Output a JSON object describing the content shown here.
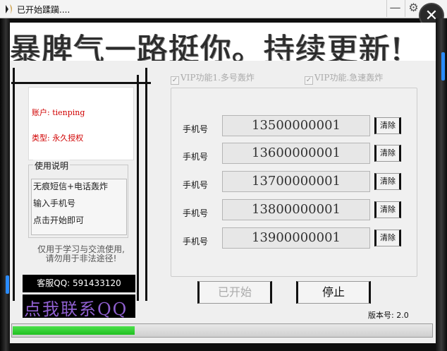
{
  "window": {
    "title": "已开始蹂躏...."
  },
  "titlebar": {
    "minimize_glyph": "—",
    "gear_glyph": "⚙",
    "close_glyph": "✕"
  },
  "banner": {
    "text": "暴脾气一路挺你。持续更新!"
  },
  "account": {
    "user_line": "账户: tienping",
    "type_line": "类型: 永久授权"
  },
  "instructions": {
    "title": "使用说明",
    "items": [
      "无痕短信+电话轰炸",
      "输入手机号",
      "点击开始即可"
    ]
  },
  "notice": {
    "line1": "仅用于学习与交流使用,",
    "line2": "请勿用于非法途径!"
  },
  "support": {
    "qq": "客服QQ: 591433120",
    "link": "点我联系QQ"
  },
  "vip": {
    "option1": "VIP功能1.多号轰炸",
    "option2": "VIP功能.急速轰炸",
    "check_glyph": "✓"
  },
  "phones": {
    "label": "手机号",
    "clear_label": "清除",
    "rows": [
      "13500000001",
      "13600000001",
      "13700000001",
      "13800000001",
      "13900000001"
    ]
  },
  "controls": {
    "start_label": "已开始",
    "stop_label": "停止"
  },
  "version": "版本号: 2.0",
  "progress": {
    "fraction": 0.29,
    "fill_color": "#22c022"
  }
}
